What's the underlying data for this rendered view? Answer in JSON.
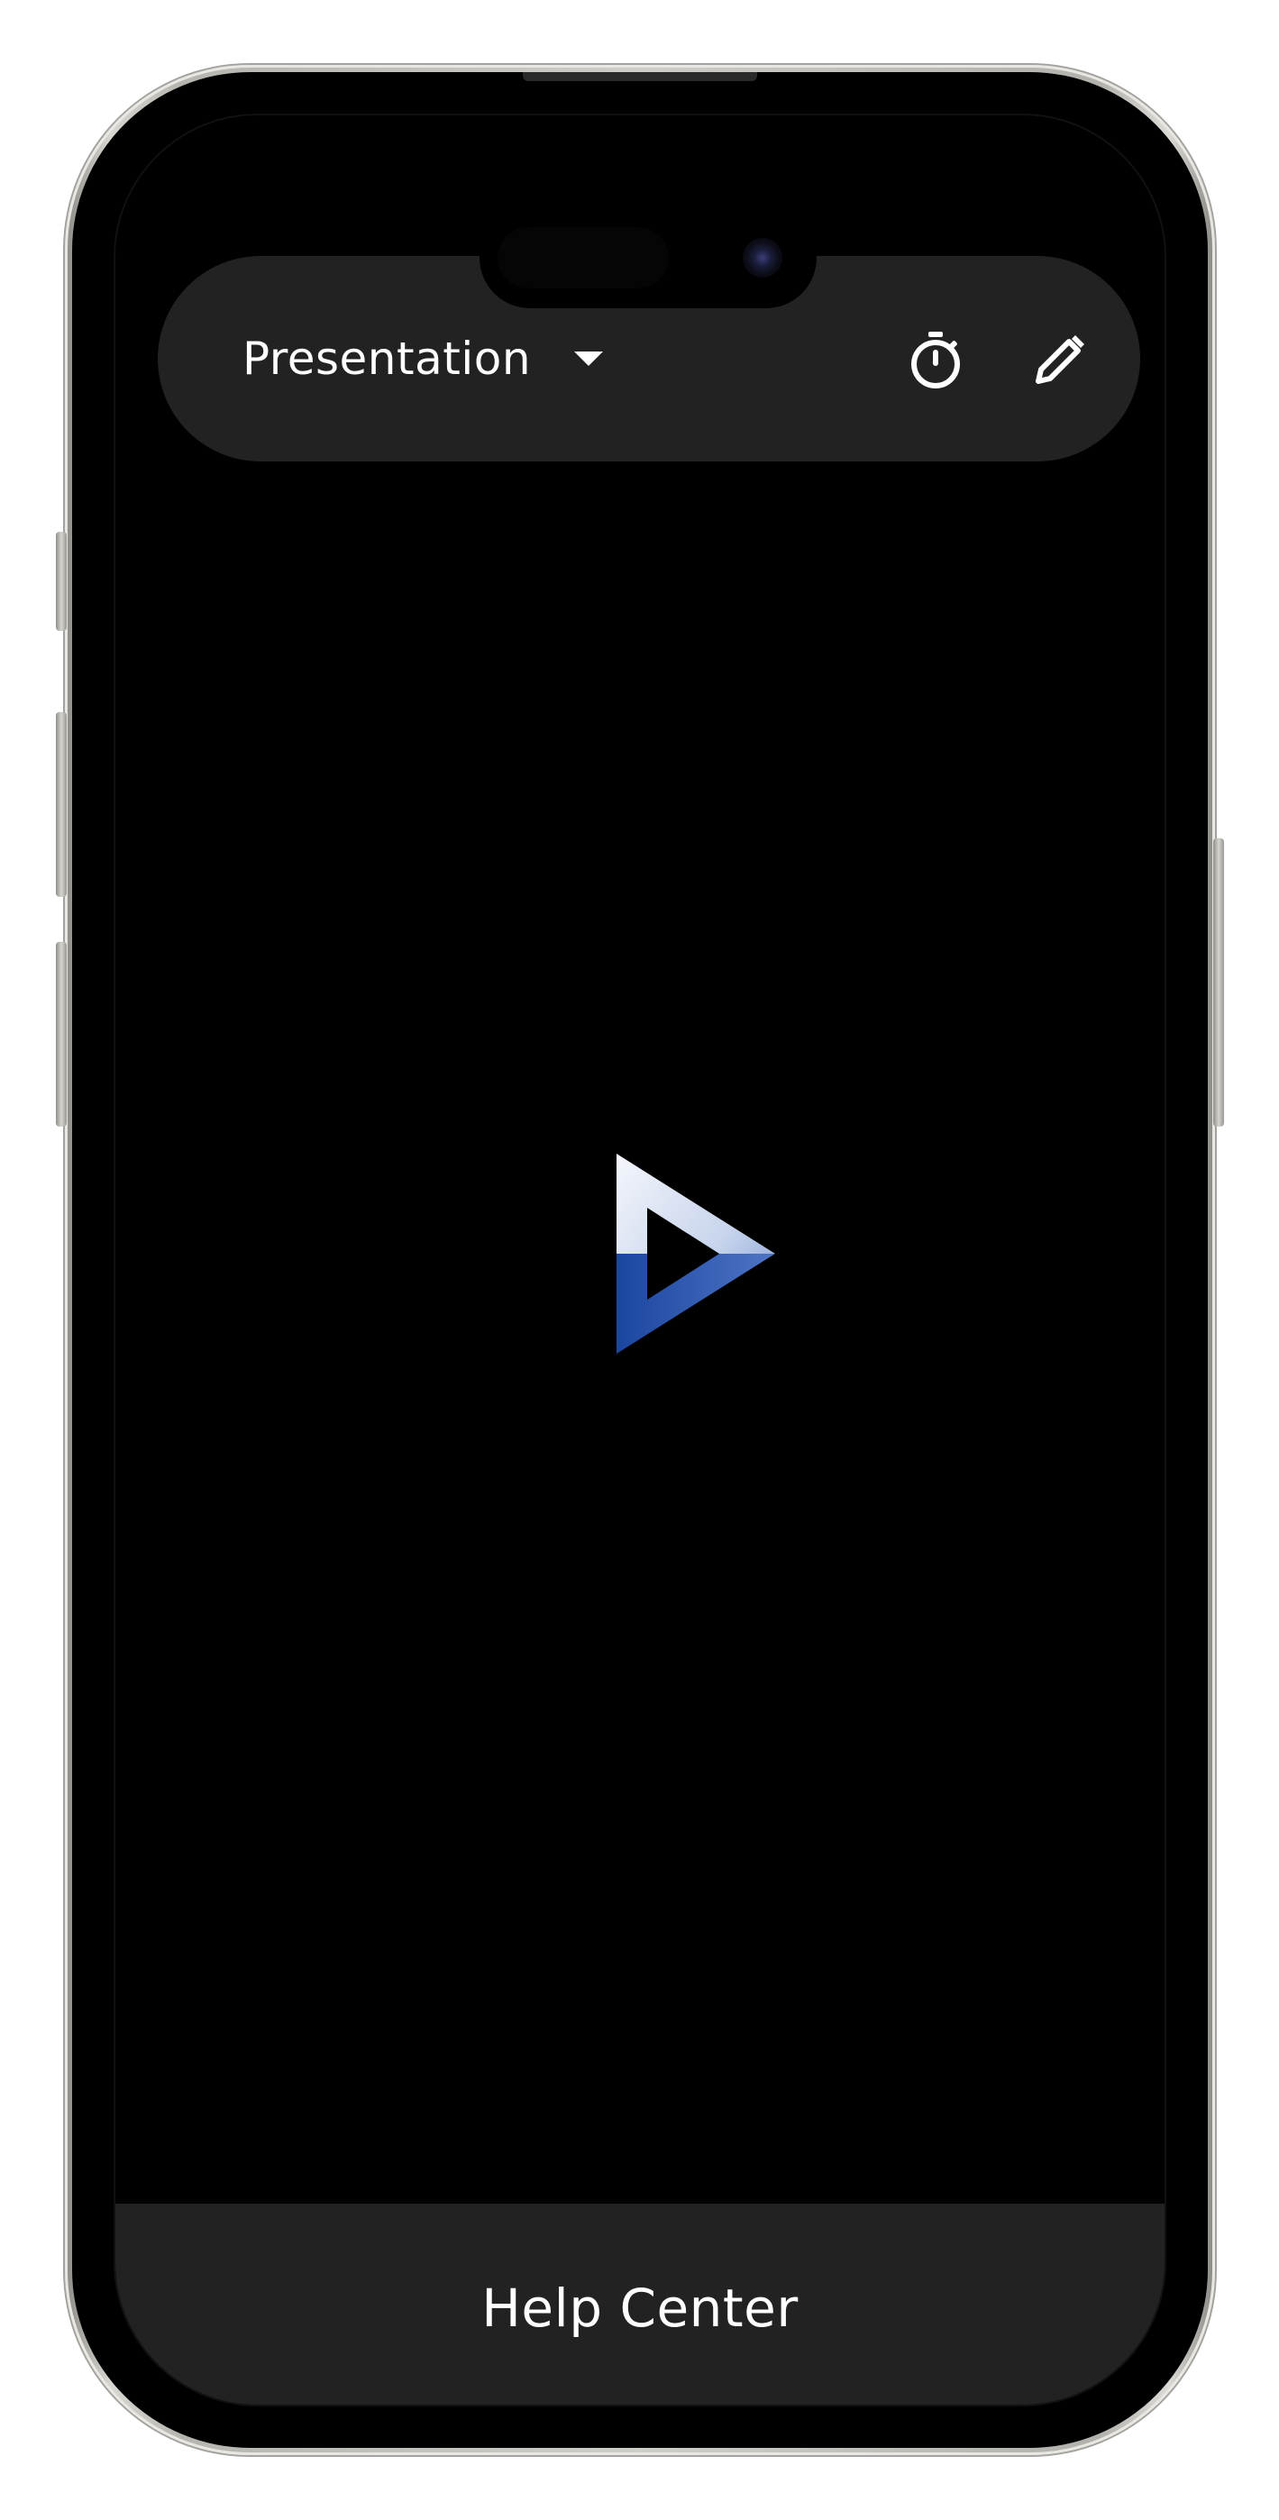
{
  "header": {
    "mode_label": "Presentation",
    "dropdown_icon": "caret-down-icon",
    "timer_icon": "stopwatch-icon",
    "edit_icon": "pencil-icon"
  },
  "center": {
    "logo_icon": "play-triangle-logo"
  },
  "footer": {
    "help_label": "Help Center"
  },
  "colors": {
    "screen_background": "#000000",
    "bar_background": "#222222",
    "text": "#ffffff",
    "logo_blue": "#1f4aa0",
    "logo_light": "#e8eef8"
  }
}
